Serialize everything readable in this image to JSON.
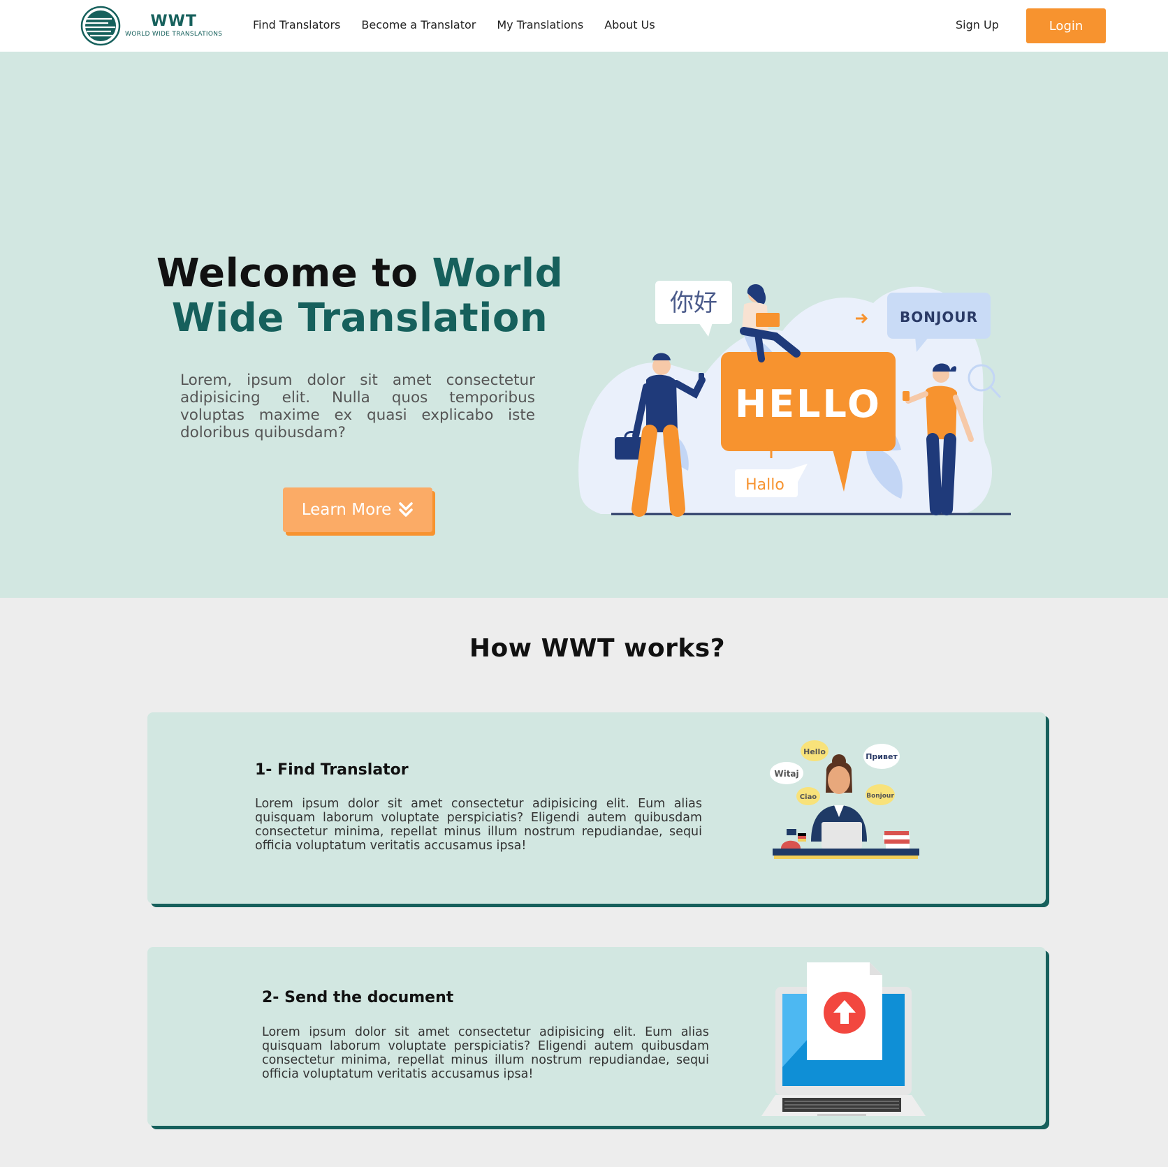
{
  "navbar": {
    "logo": {
      "title": "WWT",
      "subtitle": "WORLD WIDE TRANSLATIONS"
    },
    "links": [
      {
        "label": "Find Translators"
      },
      {
        "label": "Become a Translator"
      },
      {
        "label": "My Translations"
      },
      {
        "label": "About Us"
      }
    ],
    "signup_label": "Sign Up",
    "login_label": "Login"
  },
  "hero": {
    "title_part1": "Welcome to",
    "title_part2": "World Wide Translation",
    "description": "Lorem, ipsum dolor sit amet consectetur adipisicing elit. Nulla quos temporibus voluptas maxime ex quasi explicabo iste doloribus quibusdam?",
    "button_label": "Learn More",
    "button_icon": "double-chevron-down-icon",
    "illustration": {
      "bubbles": [
        "你好",
        "BONJOUR",
        "HELLO",
        "Hallo"
      ]
    }
  },
  "how_it_works": {
    "title": "How WWT works?",
    "steps": [
      {
        "title": "1- Find Translator",
        "text": "Lorem ipsum dolor sit amet consectetur adipisicing elit. Eum alias quisquam laborum voluptate perspiciatis? Eligendi autem quibusdam consectetur minima, repellat minus illum nostrum repudiandae, sequi officia voluptatum veritatis accusamus ipsa!",
        "bubbles": [
          "Hello",
          "Привет",
          "Witaj",
          "Ciao",
          "Bonjour"
        ]
      },
      {
        "title": "2- Send the document",
        "text": "Lorem ipsum dolor sit amet consectetur adipisicing elit. Eum alias quisquam laborum voluptate perspiciatis? Eligendi autem quibusdam consectetur minima, repellat minus illum nostrum repudiandae, sequi officia voluptatum veritatis accusamus ipsa!"
      }
    ]
  },
  "colors": {
    "brand_teal": "#16605c",
    "accent_orange": "#f7932f",
    "hero_bg": "#d2e7e1",
    "page_bg": "#ededed"
  }
}
